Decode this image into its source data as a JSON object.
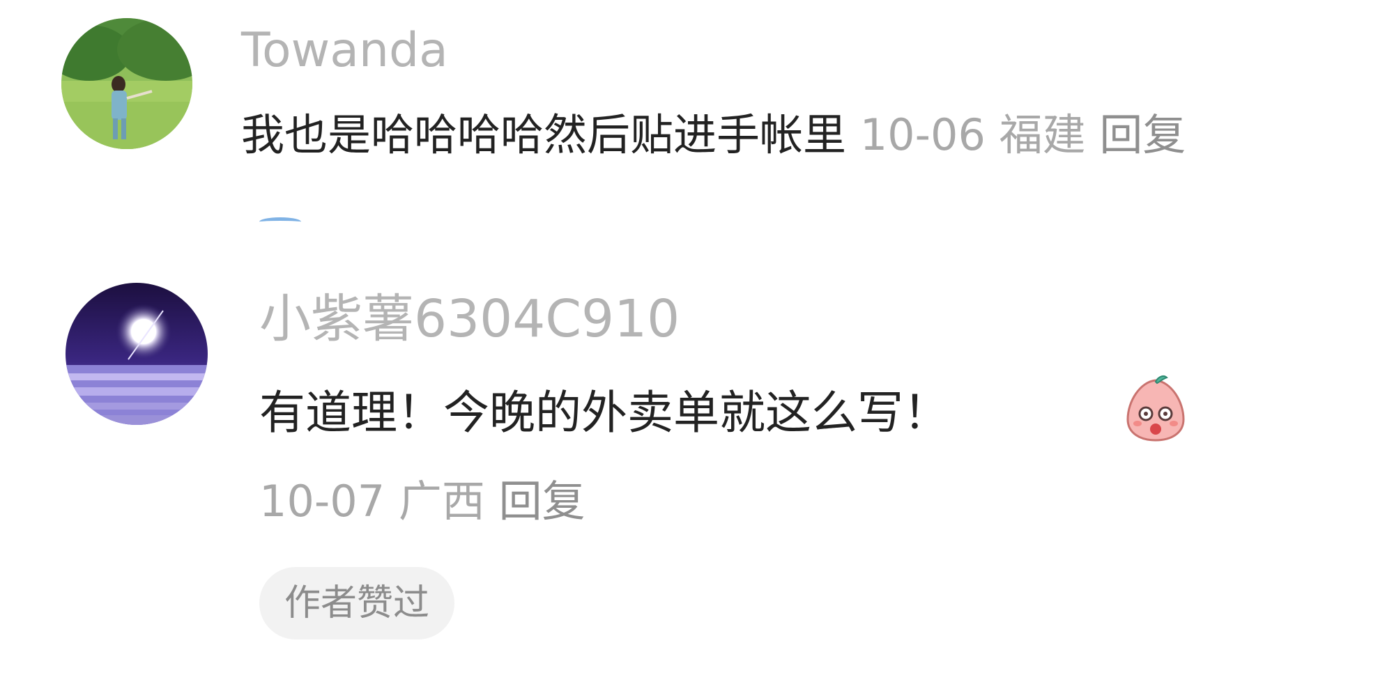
{
  "comments": [
    {
      "username": "Towanda",
      "content": "我也是哈哈哈哈然后贴进手帐里",
      "date": "10-06",
      "location": "福建",
      "reply_label": "回复",
      "avatar_icon": "user-avatar-meadow"
    },
    {
      "username": "小紫薯6304C910",
      "content": "有道理！今晚的外卖单就这么写！",
      "emoji_icon": "surprised-peach-emoji",
      "date": "10-07",
      "location": "广西",
      "reply_label": "回复",
      "author_badge": "作者赞过",
      "avatar_icon": "user-avatar-moon"
    }
  ],
  "colors": {
    "username": "#b4b4b4",
    "content": "#222222",
    "meta": "#a8a8a8",
    "badge_bg": "#f2f2f2"
  }
}
